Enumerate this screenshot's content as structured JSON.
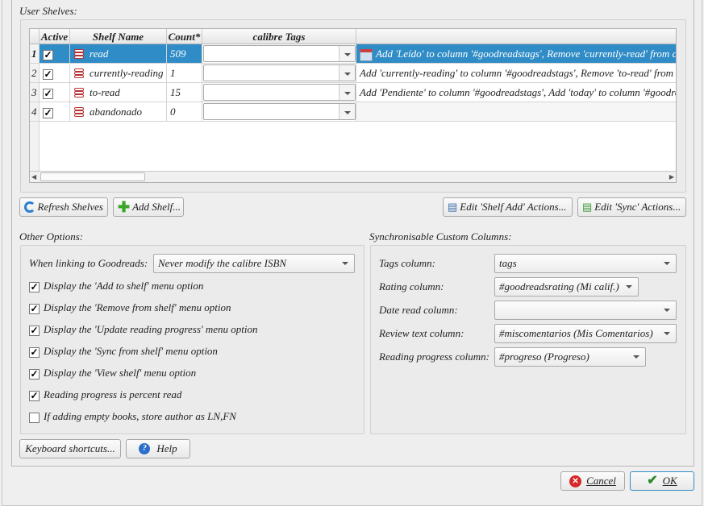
{
  "user_shelves": {
    "title": "User Shelves:",
    "columns": [
      "Active",
      "Shelf Name",
      "Count*",
      "calibre Tags",
      ""
    ],
    "rows": [
      {
        "num": "1",
        "active": true,
        "name": "read",
        "count": "509",
        "tags": "",
        "actions": "Add 'Leído' to column '#goodreadstags', Remove 'currently-read' from column",
        "selected": true
      },
      {
        "num": "2",
        "active": true,
        "name": "currently-reading",
        "count": "1",
        "tags": "",
        "actions": "Add 'currently-reading' to column '#goodreadstags', Remove 'to-read' from column"
      },
      {
        "num": "3",
        "active": true,
        "name": "to-read",
        "count": "15",
        "tags": "",
        "actions": "Add 'Pendiente' to column '#goodreadstags', Add 'today' to column '#goodreadsdate'"
      },
      {
        "num": "4",
        "active": true,
        "name": "abandonado",
        "count": "0",
        "tags": "",
        "actions": ""
      }
    ]
  },
  "buttons": {
    "refresh": "Refresh Shelves",
    "add_shelf": "Add Shelf...",
    "edit_add": "Edit 'Shelf Add' Actions...",
    "edit_sync": "Edit 'Sync' Actions...",
    "shortcuts": "Keyboard shortcuts...",
    "help": "Help",
    "cancel": "Cancel",
    "ok": "OK"
  },
  "other": {
    "title": "Other Options:",
    "link_label": "When linking to Goodreads:",
    "link_value": "Never modify the calibre ISBN",
    "options": [
      {
        "label": "Display the 'Add to shelf' menu option",
        "checked": true
      },
      {
        "label": "Display the 'Remove from shelf' menu option",
        "checked": true
      },
      {
        "label": "Display the 'Update reading progress' menu option",
        "checked": true
      },
      {
        "label": "Display the 'Sync from shelf' menu option",
        "checked": true
      },
      {
        "label": "Display the 'View shelf' menu option",
        "checked": true
      },
      {
        "label": "Reading progress is percent read",
        "checked": true
      },
      {
        "label": "If adding empty books, store author as LN,FN",
        "checked": false
      }
    ]
  },
  "sync": {
    "title": "Synchronisable Custom Columns:",
    "fields": [
      {
        "label": "Tags column:",
        "value": "tags"
      },
      {
        "label": "Rating column:",
        "value": "#goodreadsrating (Mi calif.)"
      },
      {
        "label": "Date read column:",
        "value": ""
      },
      {
        "label": "Review text column:",
        "value": "#miscomentarios (Mis Comentarios)"
      },
      {
        "label": "Reading progress column:",
        "value": "#progreso (Progreso)"
      }
    ]
  }
}
